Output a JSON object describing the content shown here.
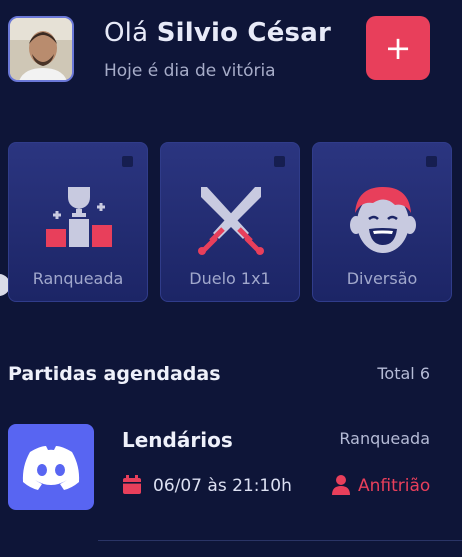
{
  "header": {
    "greeting": "Olá",
    "user_name": "Silvio César",
    "subtitle": "Hoje é dia de vitória",
    "add_label": "+"
  },
  "categories": [
    {
      "label": "Ranqueada",
      "icon": "podium-trophy-icon"
    },
    {
      "label": "Duelo 1x1",
      "icon": "crossed-swords-icon"
    },
    {
      "label": "Diversão",
      "icon": "laughing-face-icon"
    }
  ],
  "schedule": {
    "title": "Partidas agendadas",
    "total": "Total 6",
    "matches": [
      {
        "name": "Lendários",
        "category": "Ranqueada",
        "date": "06/07 às 21:10h",
        "role": "Anfitrião",
        "icon": "discord-icon"
      }
    ]
  },
  "colors": {
    "background": "#0e1538",
    "accent": "#e83f5b",
    "card": "#232d73",
    "discord": "#5865f2"
  }
}
